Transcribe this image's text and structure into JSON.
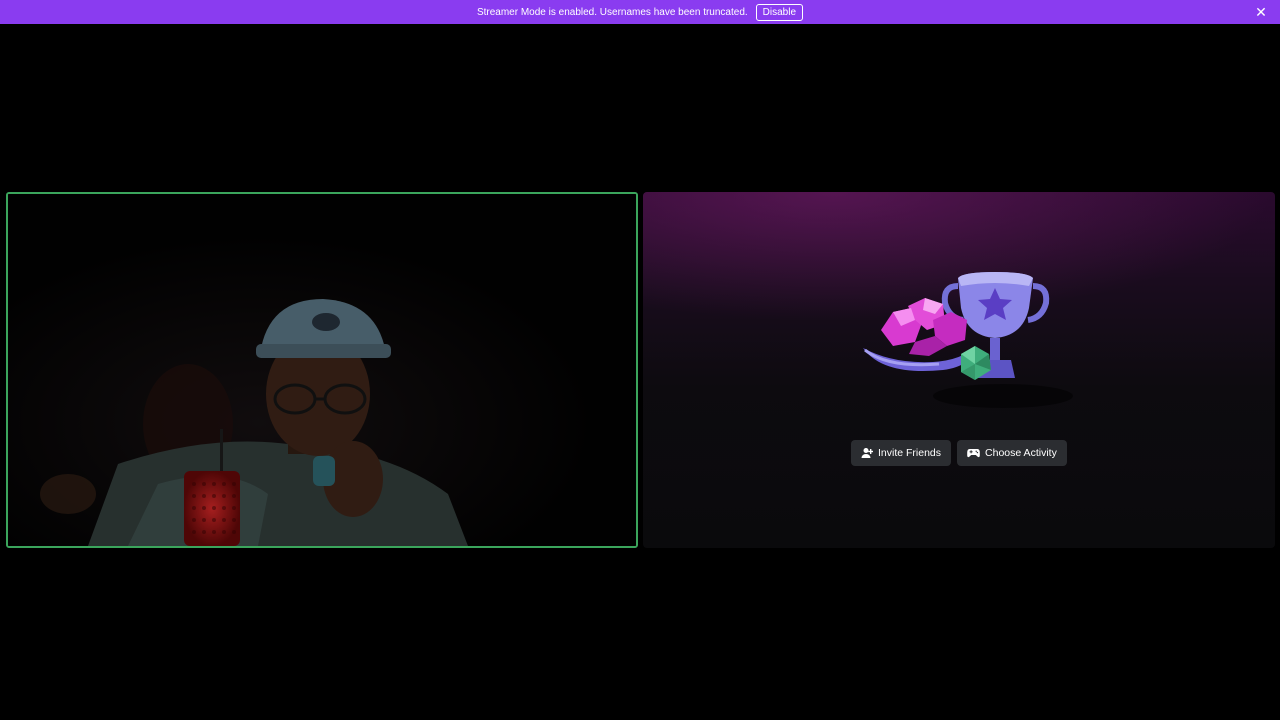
{
  "banner": {
    "message": "Streamer Mode is enabled. Usernames have been truncated.",
    "disable_label": "Disable",
    "close_icon": "close-icon",
    "background": "#8a3cf0"
  },
  "video_tile": {
    "speaking_border_color": "#3ba55c"
  },
  "activity_tile": {
    "invite_label": "Invite Friends",
    "invite_icon": "person-add-icon",
    "choose_label": "Choose Activity",
    "choose_icon": "gamepad-icon",
    "illustration_icon": "trophy-gems-dice-icon"
  },
  "colors": {
    "accent": "#8a3cf0",
    "speaking": "#3ba55c",
    "button_bg": "#2b2d31"
  }
}
